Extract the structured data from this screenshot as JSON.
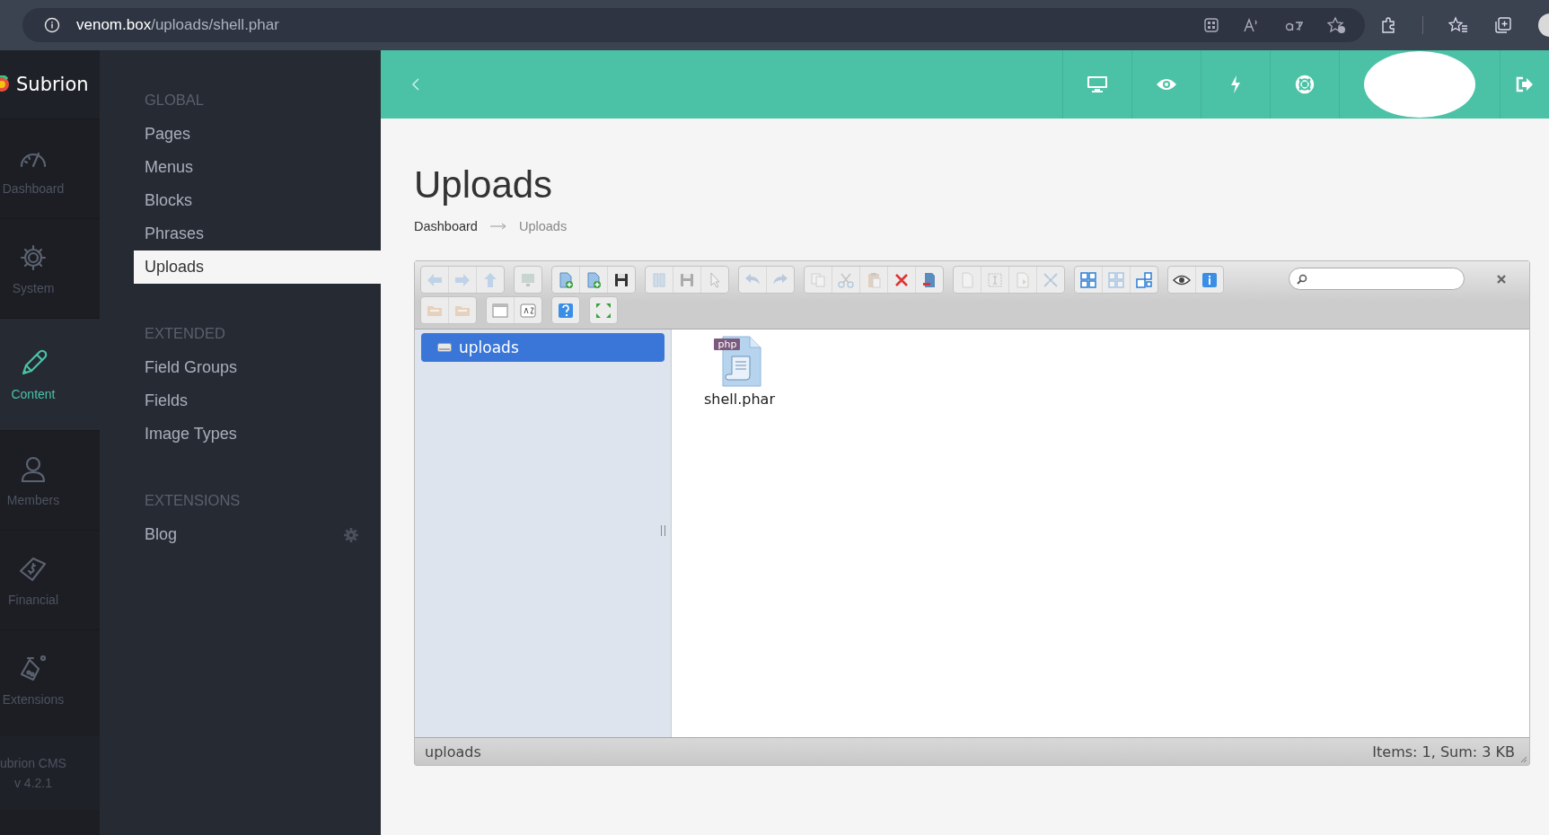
{
  "browser": {
    "url_host": "venom.box",
    "url_path": "/uploads/shell.phar"
  },
  "brand": {
    "name": "Subrion"
  },
  "rail": [
    {
      "label": "Dashboard",
      "selected": false
    },
    {
      "label": "System",
      "selected": false
    },
    {
      "label": "Content",
      "selected": true
    },
    {
      "label": "Members",
      "selected": false
    },
    {
      "label": "Financial",
      "selected": false
    },
    {
      "label": "Extensions",
      "selected": false
    }
  ],
  "rail_footer": {
    "name": "ubrion CMS",
    "version": "v 4.2.1"
  },
  "submenu": [
    {
      "heading": "GLOBAL",
      "items": [
        {
          "label": "Pages",
          "selected": false
        },
        {
          "label": "Menus",
          "selected": false
        },
        {
          "label": "Blocks",
          "selected": false
        },
        {
          "label": "Phrases",
          "selected": false
        },
        {
          "label": "Uploads",
          "selected": true
        }
      ]
    },
    {
      "heading": "EXTENDED",
      "items": [
        {
          "label": "Field Groups",
          "selected": false
        },
        {
          "label": "Fields",
          "selected": false
        },
        {
          "label": "Image Types",
          "selected": false
        }
      ]
    },
    {
      "heading": "EXTENSIONS",
      "items": [
        {
          "label": "Blog",
          "selected": false,
          "settings": true
        }
      ]
    }
  ],
  "page": {
    "title": "Uploads",
    "breadcrumb": [
      "Dashboard",
      "Uploads"
    ]
  },
  "toolbar": [
    [
      {
        "disabled": true
      },
      {
        "disabled": true
      },
      {
        "disabled": true
      }
    ],
    [
      {
        "disabled": true
      }
    ],
    [
      {
        "disabled": false
      },
      {
        "disabled": false
      },
      {
        "disabled": false
      }
    ],
    [
      {
        "disabled": true
      },
      {
        "disabled": true
      },
      {
        "disabled": true
      }
    ],
    [
      {
        "disabled": true
      },
      {
        "disabled": true
      }
    ],
    [
      {
        "disabled": true
      },
      {
        "disabled": true
      },
      {
        "disabled": true
      },
      {
        "disabled": false
      },
      {
        "disabled": false
      }
    ],
    [
      {
        "disabled": true
      },
      {
        "disabled": true
      },
      {
        "disabled": true
      },
      {
        "disabled": true
      }
    ],
    [
      {
        "disabled": false
      },
      {
        "disabled": true
      },
      {
        "disabled": false
      }
    ],
    [
      {
        "disabled": false
      },
      {
        "disabled": false
      }
    ],
    [
      {
        "disabled": true
      },
      {
        "disabled": true
      }
    ],
    [
      {
        "disabled": false
      },
      {
        "disabled": false
      }
    ],
    [
      {
        "disabled": false
      }
    ],
    [
      {
        "disabled": false
      }
    ]
  ],
  "tree": [
    {
      "label": "uploads",
      "selected": true
    }
  ],
  "files": [
    {
      "name": "shell.phar",
      "badge": "php"
    }
  ],
  "status": {
    "path": "uploads",
    "summary": "Items: 1, Sum: 3 KB"
  }
}
